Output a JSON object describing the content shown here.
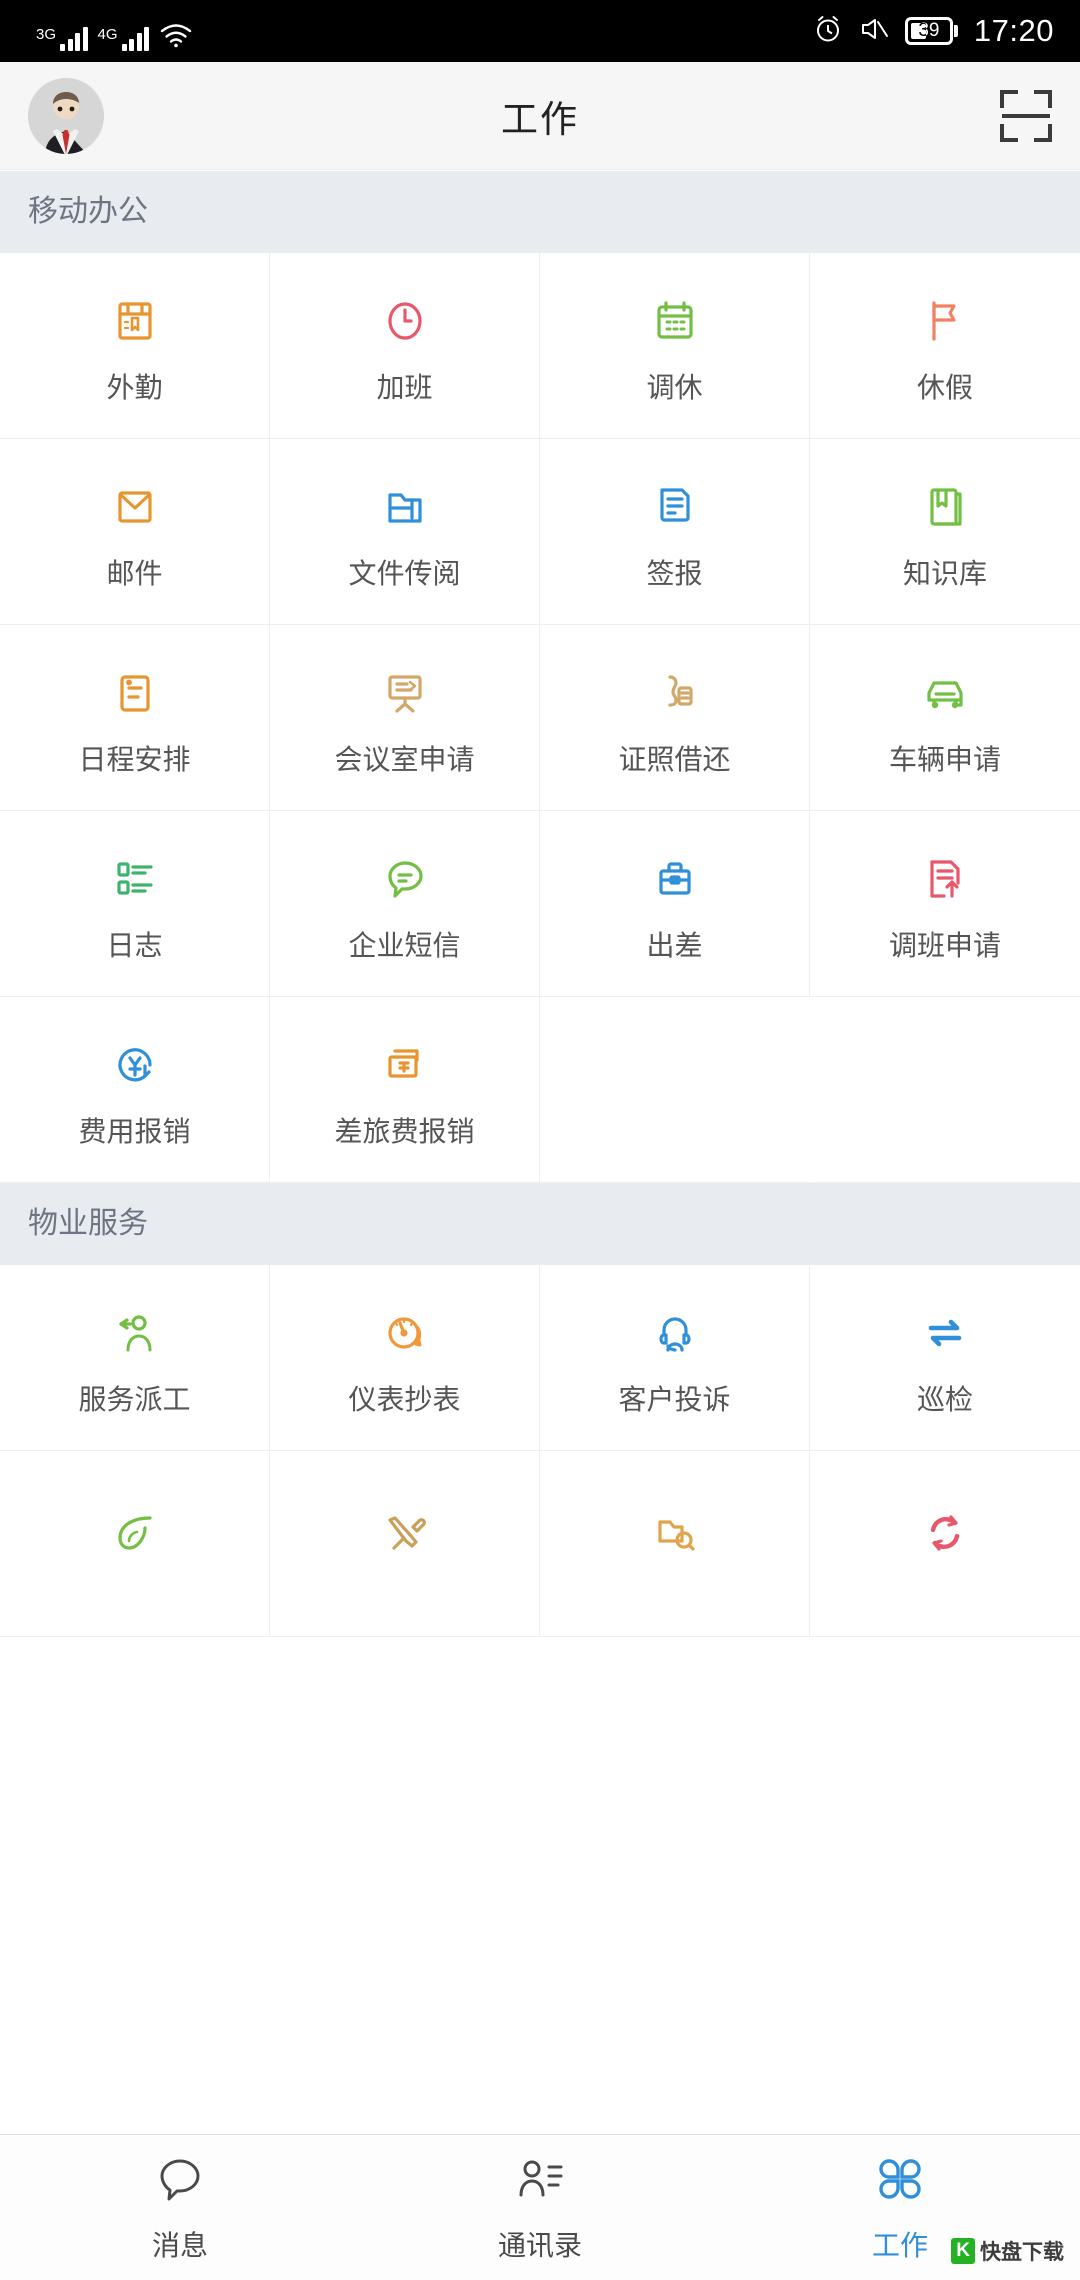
{
  "statusbar": {
    "net1_label": "3G",
    "net2_label": "4G",
    "wifi_icon": "wifi-icon",
    "alarm_icon": "alarm-icon",
    "mute_icon": "mute-icon",
    "battery_level": "39",
    "time": "17:20"
  },
  "header": {
    "title": "工作",
    "avatar_icon": "avatar",
    "scan_icon": "scan-icon"
  },
  "sections": [
    {
      "title": "移动办公",
      "items": [
        {
          "label": "外勤",
          "icon": "field-work-icon",
          "color": "#e8952f"
        },
        {
          "label": "加班",
          "icon": "clock-icon",
          "color": "#e8576a"
        },
        {
          "label": "调休",
          "icon": "calendar-icon",
          "color": "#72bf44"
        },
        {
          "label": "休假",
          "icon": "flag-icon",
          "color": "#f08162"
        },
        {
          "label": "邮件",
          "icon": "envelope-icon",
          "color": "#e8952f"
        },
        {
          "label": "文件传阅",
          "icon": "folder-icon",
          "color": "#2f8fd8"
        },
        {
          "label": "签报",
          "icon": "document-icon",
          "color": "#2f8fd8"
        },
        {
          "label": "知识库",
          "icon": "book-icon",
          "color": "#72bf44"
        },
        {
          "label": "日程安排",
          "icon": "schedule-icon",
          "color": "#e8952f"
        },
        {
          "label": "会议室申请",
          "icon": "meeting-room-icon",
          "color": "#d2a86a"
        },
        {
          "label": "证照借还",
          "icon": "certificate-icon",
          "color": "#d2a86a"
        },
        {
          "label": "车辆申请",
          "icon": "car-icon",
          "color": "#72bf44"
        },
        {
          "label": "日志",
          "icon": "log-list-icon",
          "color": "#3db36b"
        },
        {
          "label": "企业短信",
          "icon": "sms-bubble-icon",
          "color": "#72bf44"
        },
        {
          "label": "出差",
          "icon": "briefcase-icon",
          "color": "#2f8fd8"
        },
        {
          "label": "调班申请",
          "icon": "shift-change-icon",
          "color": "#e8576a"
        },
        {
          "label": "费用报销",
          "icon": "expense-refund-icon",
          "color": "#2f8fd8"
        },
        {
          "label": "差旅费报销",
          "icon": "travel-expense-icon",
          "color": "#e8952f"
        }
      ]
    },
    {
      "title": "物业服务",
      "items": [
        {
          "label": "服务派工",
          "icon": "dispatch-icon",
          "color": "#72bf44"
        },
        {
          "label": "仪表抄表",
          "icon": "meter-reading-icon",
          "color": "#f0983c"
        },
        {
          "label": "客户投诉",
          "icon": "headset-customer-icon",
          "color": "#2f8fd8"
        },
        {
          "label": "巡检",
          "icon": "patrol-swap-icon",
          "color": "#2f8fd8"
        },
        {
          "label": "",
          "icon": "leaf-green-icon",
          "color": "#72bf44"
        },
        {
          "label": "",
          "icon": "tools-icon",
          "color": "#c8a05a"
        },
        {
          "label": "",
          "icon": "folder-search-icon",
          "color": "#e0a54a"
        },
        {
          "label": "",
          "icon": "refresh-cycle-icon",
          "color": "#e8576a"
        }
      ]
    }
  ],
  "tabbar": {
    "items": [
      {
        "label": "消息",
        "icon": "chat-bubble-icon",
        "active": false
      },
      {
        "label": "通讯录",
        "icon": "contacts-icon",
        "active": false
      },
      {
        "label": "工作",
        "icon": "grid-work-icon",
        "active": true
      }
    ],
    "active_color": "#2f8fd8"
  },
  "watermark": {
    "badge": "K",
    "text": "快盘下载"
  }
}
